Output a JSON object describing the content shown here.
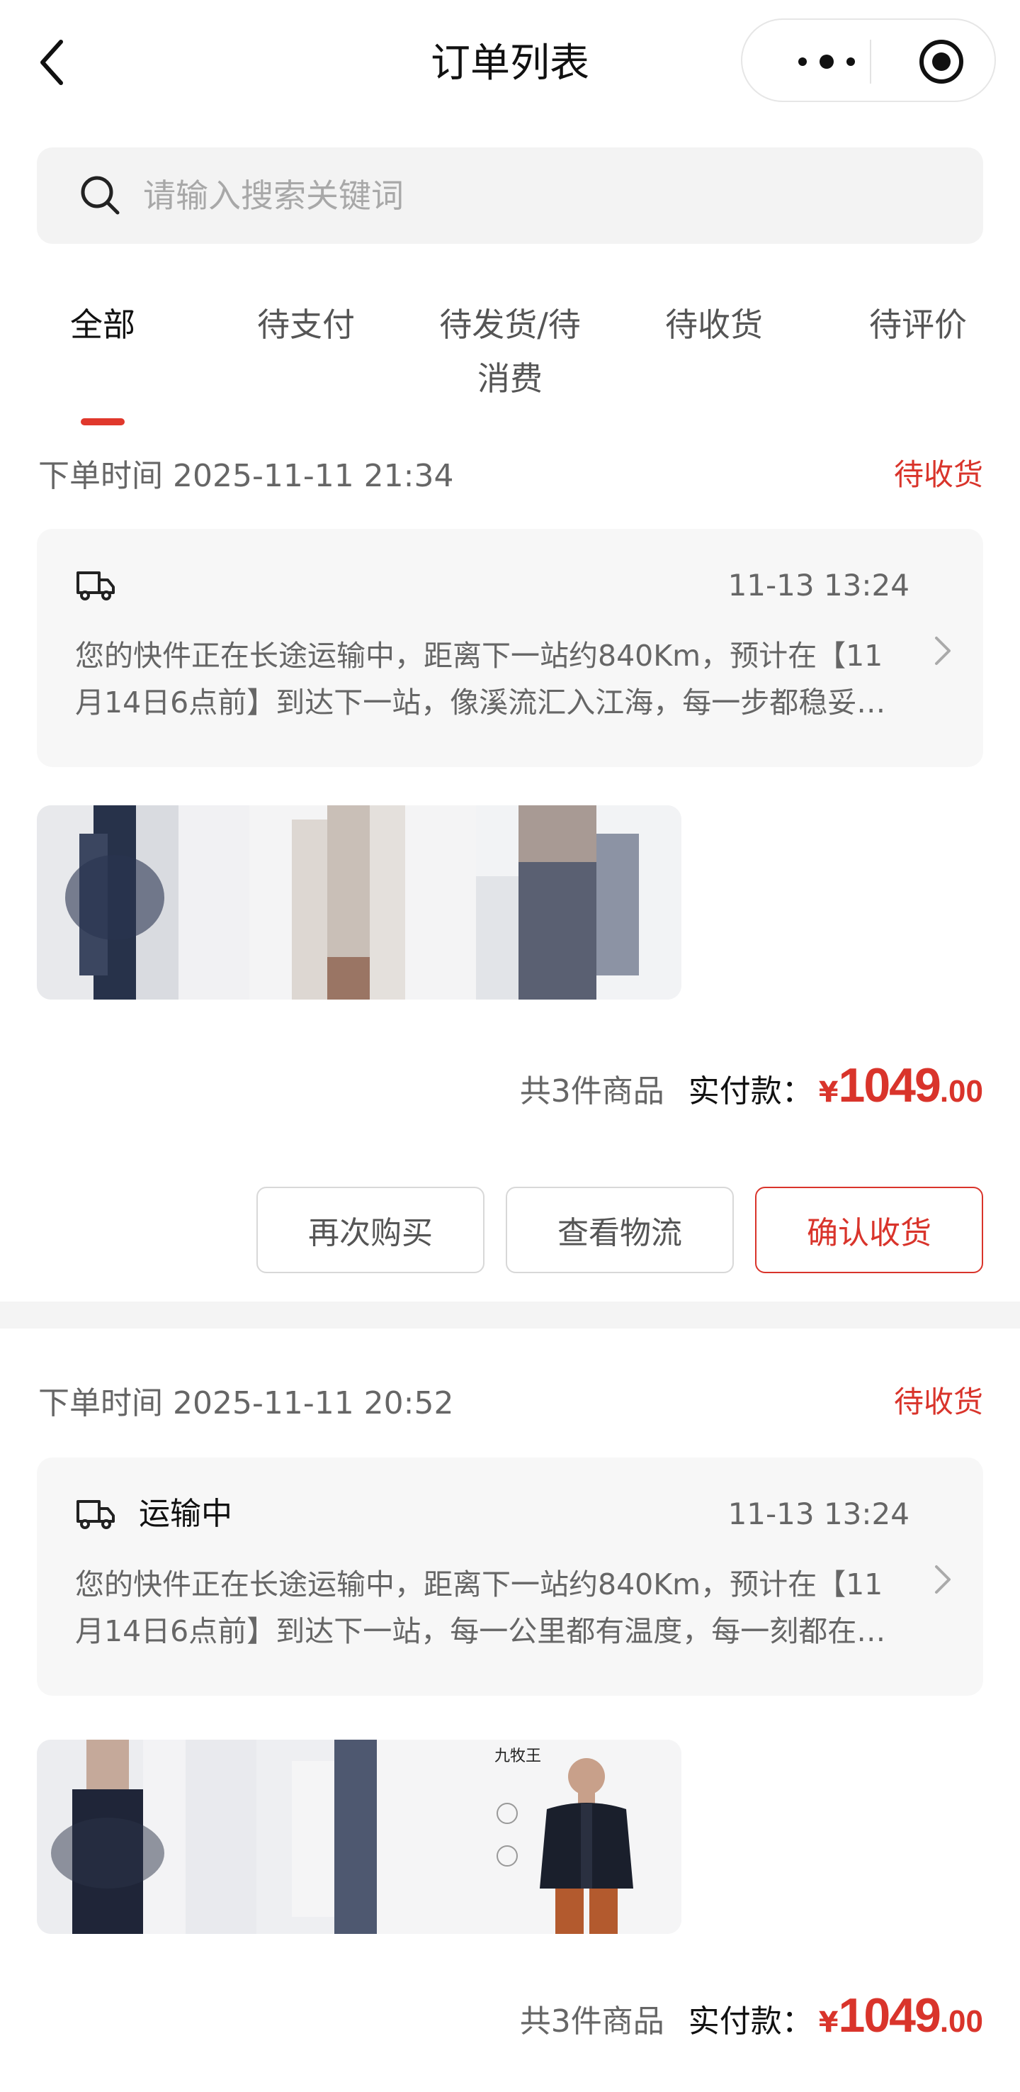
{
  "header": {
    "title": "订单列表",
    "back_icon": "chevron-left-icon",
    "more_icon": "more-dots-icon",
    "home_icon": "target-circle-icon"
  },
  "search": {
    "placeholder": "请输入搜索关键词",
    "value": "",
    "icon": "search-icon"
  },
  "tabs": [
    {
      "label": "全部",
      "active": true
    },
    {
      "label": "待支付",
      "active": false
    },
    {
      "label": "待发货/待消费",
      "active": false
    },
    {
      "label": "待收货",
      "active": false
    },
    {
      "label": "待评价",
      "active": false
    }
  ],
  "orders": [
    {
      "time": "下单时间 2025-11-11 21:34",
      "status": "待收货",
      "logistics": {
        "title": "",
        "time": "11-13 13:24",
        "desc": "您的快件正在长途运输中，距离下一站约840Km，预计在【11月14日6点前】到达下一站，像溪流汇入江海，每一步都稳妥…"
      },
      "summary": {
        "count": "共3件商品",
        "pay_label": "实付款：",
        "currency": "¥",
        "int": "1049",
        "dec": ".00"
      },
      "buttons": [
        "再次购买",
        "查看物流",
        "确认收货"
      ]
    },
    {
      "time": "下单时间 2025-11-11 20:52",
      "status": "待收货",
      "logistics": {
        "title": "运输中",
        "time": "11-13 13:24",
        "desc": "您的快件正在长途运输中，距离下一站约840Km，预计在【11月14日6点前】到达下一站，每一公里都有温度，每一刻都在…"
      },
      "summary": {
        "count": "共3件商品",
        "pay_label": "实付款：",
        "currency": "¥",
        "int": "1049",
        "dec": ".00"
      },
      "buttons": []
    }
  ],
  "colors": {
    "accent": "#d9342b",
    "tab_indicator": "#e0382c",
    "card_bg": "#f7f7f7",
    "search_bg": "#f3f3f3"
  },
  "brand": {
    "product_logo": "九牧王"
  }
}
